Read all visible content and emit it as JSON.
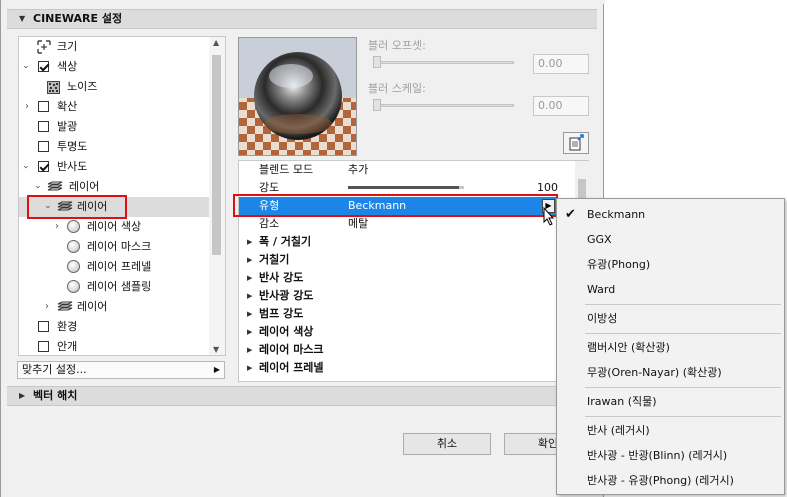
{
  "sections": {
    "cineware": "CINEWARE 설정",
    "vector_hatch": "벡터 해치"
  },
  "tree": {
    "items": [
      {
        "label": "크기"
      },
      {
        "label": "색상"
      },
      {
        "label": "노이즈"
      },
      {
        "label": "확산"
      },
      {
        "label": "발광"
      },
      {
        "label": "투명도"
      },
      {
        "label": "반사도"
      },
      {
        "label": "레이어"
      },
      {
        "label": "레이어"
      },
      {
        "label": "레이어 색상"
      },
      {
        "label": "레이어 마스크"
      },
      {
        "label": "레이어 프레넬"
      },
      {
        "label": "레이어 샘플링"
      },
      {
        "label": "레이어"
      },
      {
        "label": "환경"
      },
      {
        "label": "안개"
      }
    ]
  },
  "preset": {
    "label": "맞추기 설정..."
  },
  "preview": {
    "blur_offset_label": "블러 오프셋:",
    "blur_offset_value": "0.00",
    "blur_scale_label": "블러 스케일:",
    "blur_scale_value": "0.00"
  },
  "props": {
    "rows": [
      {
        "key": "블렌드 모드",
        "value": "추가"
      },
      {
        "key": "강도",
        "value": "100",
        "level": 0.96
      },
      {
        "key": "유형",
        "value": "Beckmann"
      },
      {
        "key": "감소",
        "value": "메탈"
      }
    ],
    "groups": [
      "폭 / 거칠기",
      "거칠기",
      "반사 강도",
      "반사광 강도",
      "범프 강도",
      "레이어 색상",
      "레이어 마스크",
      "레이어 프레넬"
    ]
  },
  "buttons": {
    "cancel": "취소",
    "ok": "확인"
  },
  "menu": {
    "items": [
      "Beckmann",
      "GGX",
      "유광(Phong)",
      "Ward",
      "이방성",
      "램버시안 (확산광)",
      "무광(Oren-Nayar) (확산광)",
      "Irawan (직물)",
      "반사 (레거시)",
      "반사광 - 반광(Blinn) (레거시)",
      "반사광 - 유광(Phong) (레거시)"
    ],
    "checked": "Beckmann"
  },
  "colors": {
    "selection": "#1c86e8",
    "highlight_border": "#e01010"
  }
}
